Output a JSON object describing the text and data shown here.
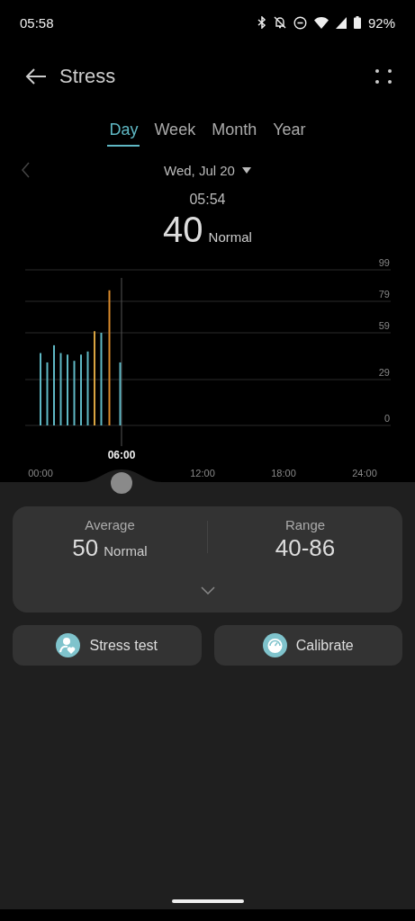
{
  "status_bar": {
    "time": "05:58",
    "battery": "92%"
  },
  "header": {
    "title": "Stress"
  },
  "tabs": [
    {
      "label": "Day",
      "selected": true
    },
    {
      "label": "Week",
      "selected": false
    },
    {
      "label": "Month",
      "selected": false
    },
    {
      "label": "Year",
      "selected": false
    }
  ],
  "date_picker": {
    "date": "Wed, Jul 20"
  },
  "reading": {
    "time": "05:54",
    "value": "40",
    "status": "Normal"
  },
  "chart": {
    "chart_data": {
      "type": "bar",
      "x": [
        0,
        0.5,
        1,
        1.5,
        2,
        2.5,
        3,
        3.5,
        4,
        4.5,
        5.1,
        5.9
      ],
      "series": [
        {
          "color": "#5fb8c4",
          "values": [
            46,
            40,
            51,
            46,
            45,
            41,
            45,
            47,
            null,
            59,
            null,
            40
          ]
        },
        {
          "color": "#d9a441",
          "values": [
            null,
            null,
            null,
            null,
            null,
            null,
            null,
            null,
            60,
            null,
            null,
            null
          ]
        },
        {
          "color": "#d98a2b",
          "values": [
            null,
            null,
            null,
            null,
            null,
            null,
            null,
            null,
            null,
            null,
            86,
            null
          ]
        }
      ],
      "grid": true,
      "xlim": [
        0,
        24
      ],
      "ylim": [
        0,
        99
      ],
      "xticks": [
        {
          "value": 0,
          "label": "00:00"
        },
        {
          "value": 12,
          "label": "12:00"
        },
        {
          "value": 18,
          "label": "18:00"
        },
        {
          "value": 24,
          "label": "24:00"
        }
      ],
      "yticks": [
        0,
        29,
        59,
        79,
        99
      ],
      "ref_lines": [
        {
          "axis": "x",
          "value": 6,
          "label": "06:00"
        }
      ]
    }
  },
  "summary": [
    {
      "label": "Average",
      "value": "50",
      "status": "Normal"
    },
    {
      "label": "Range",
      "value": "40-86"
    }
  ],
  "actions": [
    {
      "label": "Stress test",
      "kind": "test"
    },
    {
      "label": "Calibrate",
      "kind": "calibrate"
    }
  ]
}
